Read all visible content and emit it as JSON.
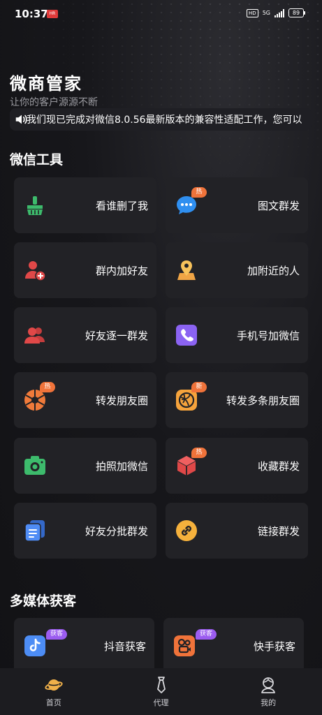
{
  "status_bar": {
    "time": "10:37",
    "app_badge": "HR",
    "hd": "HD",
    "network": "5G",
    "battery": "89"
  },
  "header": {
    "title": "微商管家",
    "subtitle": "让你的客户源源不断",
    "notice": "我们现已完成对微信8.0.56最新版本的兼容性适配工作，您可以"
  },
  "wechat_tools": {
    "title": "微信工具",
    "items": [
      {
        "label": "看谁删了我",
        "icon": "broom-icon",
        "tag": ""
      },
      {
        "label": "图文群发",
        "icon": "chat-bubble-icon",
        "tag": "热"
      },
      {
        "label": "群内加好友",
        "icon": "user-add-icon",
        "tag": ""
      },
      {
        "label": "加附近的人",
        "icon": "location-user-icon",
        "tag": ""
      },
      {
        "label": "好友逐一群发",
        "icon": "users-icon",
        "tag": ""
      },
      {
        "label": "手机号加微信",
        "icon": "phone-icon",
        "tag": ""
      },
      {
        "label": "转发朋友圈",
        "icon": "aperture-icon",
        "tag": "热"
      },
      {
        "label": "转发多条朋友圈",
        "icon": "aperture-circle-icon",
        "tag": "新"
      },
      {
        "label": "拍照加微信",
        "icon": "camera-icon",
        "tag": ""
      },
      {
        "label": "收藏群发",
        "icon": "cube-icon",
        "tag": "热"
      },
      {
        "label": "好友分批群发",
        "icon": "document-stack-icon",
        "tag": ""
      },
      {
        "label": "链接群发",
        "icon": "link-icon",
        "tag": ""
      }
    ]
  },
  "media": {
    "title": "多媒体获客",
    "items": [
      {
        "label": "抖音获客",
        "icon": "douyin-icon",
        "tag": "获客"
      },
      {
        "label": "快手获客",
        "icon": "kuaishou-icon",
        "tag": "获客"
      }
    ]
  },
  "bottom_nav": [
    {
      "label": "首页",
      "icon": "planet-icon"
    },
    {
      "label": "代理",
      "icon": "tie-icon"
    },
    {
      "label": "我的",
      "icon": "user-icon"
    }
  ],
  "colors": {
    "background": "#141418",
    "tile": "#222226",
    "hot_tag": "#f0733a",
    "get_tag": "#9b5cf0"
  }
}
